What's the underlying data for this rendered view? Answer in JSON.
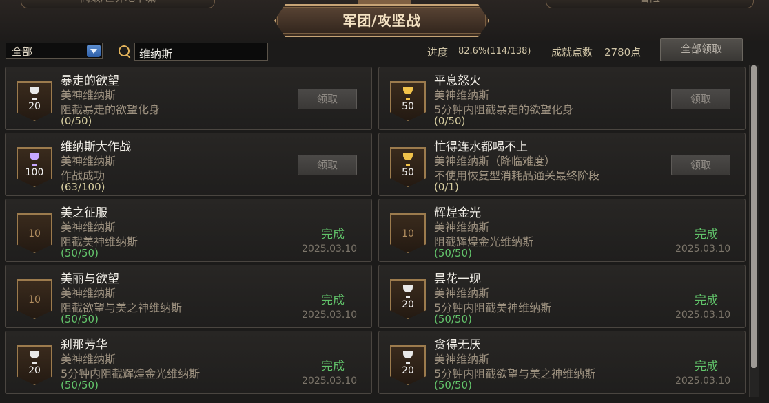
{
  "header": {
    "left_tab": "高级/世界地下城",
    "right_tab": "冒险",
    "title": "军团/攻坚战"
  },
  "filters": {
    "category": "全部",
    "search_value": "维纳斯"
  },
  "progress": {
    "label": "进度",
    "value": "82.6%(114/138)",
    "points_label": "成就点数",
    "points_value": "2780点",
    "claim_all": "全部领取"
  },
  "achievements": [
    {
      "title": "暴走的欲望",
      "line2": "美神维纳斯",
      "line3": "阻截暴走的欲望化身",
      "progress": "(0/50)",
      "badge": "20",
      "trophy": "silver",
      "state": "claim",
      "claim": "领取"
    },
    {
      "title": "平息怒火",
      "line2": "美神维纳斯",
      "line3": "5分钟内阻截暴走的欲望化身",
      "progress": "(0/50)",
      "badge": "50",
      "trophy": "gold",
      "state": "claim",
      "claim": "领取"
    },
    {
      "title": "维纳斯大作战",
      "line2": "美神维纳斯",
      "line3": "作战成功",
      "progress": "(63/100)",
      "badge": "100",
      "trophy": "purple",
      "state": "claim",
      "claim": "领取"
    },
    {
      "title": "忙得连水都喝不上",
      "line2": "美神维纳斯（降临难度）",
      "line3": "不使用恢复型消耗品通关最终阶段",
      "progress": "(0/1)",
      "badge": "50",
      "trophy": "gold",
      "state": "claim",
      "claim": "领取"
    },
    {
      "title": "美之征服",
      "line2": "美神维纳斯",
      "line3": "阻截美神维纳斯",
      "progress": "(50/50)",
      "badge": "10",
      "trophy": "none",
      "state": "done",
      "done": "完成",
      "date": "2025.03.10"
    },
    {
      "title": "辉煌金光",
      "line2": "美神维纳斯",
      "line3": "阻截辉煌金光维纳斯",
      "progress": "(50/50)",
      "badge": "10",
      "trophy": "none",
      "state": "done",
      "done": "完成",
      "date": "2025.03.10"
    },
    {
      "title": "美丽与欲望",
      "line2": "美神维纳斯",
      "line3": "阻截欲望与美之神维纳斯",
      "progress": "(50/50)",
      "badge": "10",
      "trophy": "none",
      "state": "done",
      "done": "完成",
      "date": "2025.03.10"
    },
    {
      "title": "昙花一现",
      "line2": "美神维纳斯",
      "line3": "5分钟内阻截美神维纳斯",
      "progress": "(50/50)",
      "badge": "20",
      "trophy": "silver",
      "state": "done",
      "done": "完成",
      "date": "2025.03.10"
    },
    {
      "title": "刹那芳华",
      "line2": "美神维纳斯",
      "line3": "5分钟内阻截辉煌金光维纳斯",
      "progress": "(50/50)",
      "badge": "20",
      "trophy": "silver",
      "state": "done",
      "done": "完成",
      "date": "2025.03.10"
    },
    {
      "title": "贪得无厌",
      "line2": "美神维纳斯",
      "line3": "5分钟内阻截欲望与美之神维纳斯",
      "progress": "(50/50)",
      "badge": "20",
      "trophy": "silver",
      "state": "done",
      "done": "完成",
      "date": "2025.03.10"
    }
  ]
}
